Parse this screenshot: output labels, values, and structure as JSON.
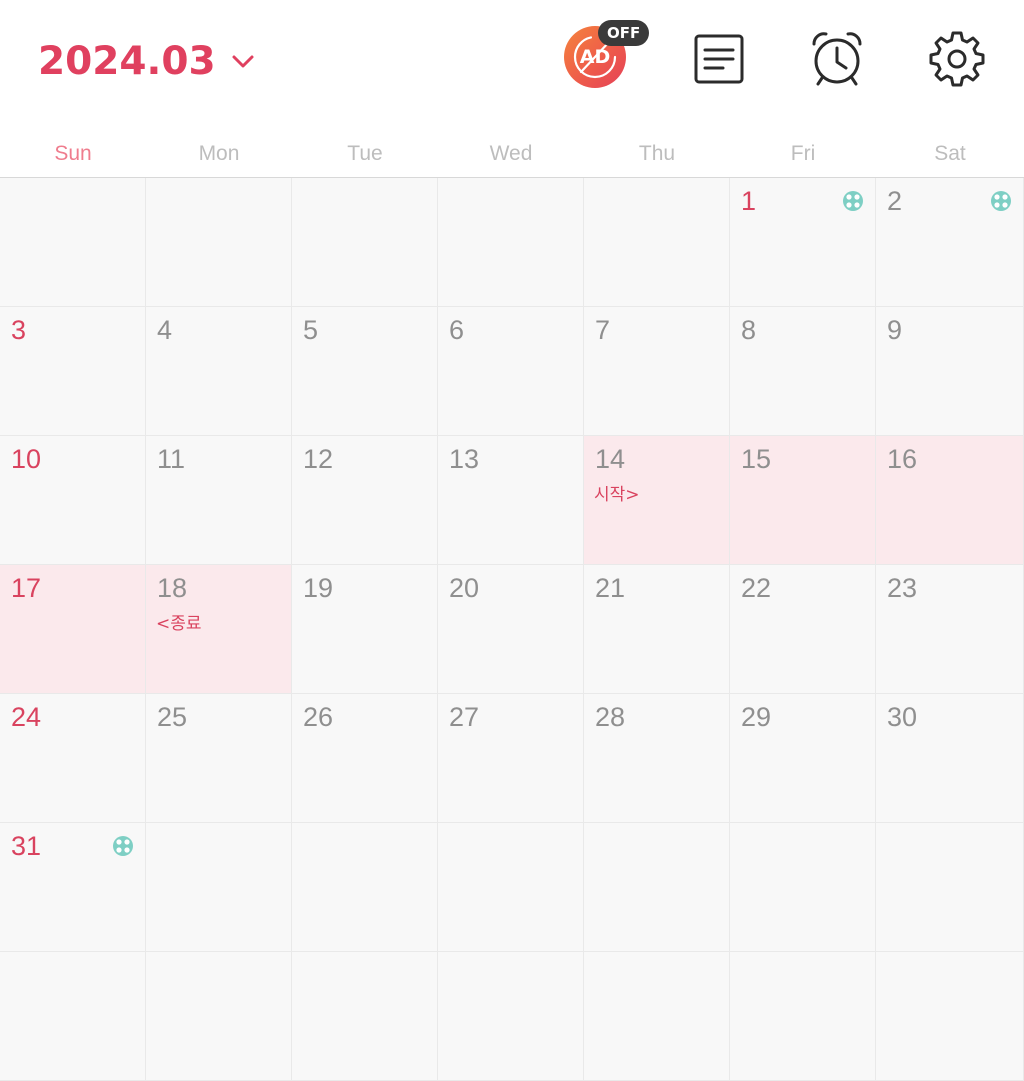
{
  "header": {
    "month_title": "2024.03",
    "ad_button": {
      "label": "AD",
      "badge": "OFF"
    },
    "icons": [
      "chevron-down-icon",
      "memo-icon",
      "alarm-clock-icon",
      "gear-icon"
    ]
  },
  "weekdays": [
    "Sun",
    "Mon",
    "Tue",
    "Wed",
    "Thu",
    "Fri",
    "Sat"
  ],
  "colors": {
    "accent": "#e0405f",
    "sunday_holiday": "#d9435f",
    "range_highlight": "#fbe9ec",
    "event_dot": "#7ecfc4",
    "ad_gradient_start": "#f5843c",
    "ad_gradient_end": "#e54158"
  },
  "calendar": {
    "weeks": [
      [
        {
          "day": ""
        },
        {
          "day": ""
        },
        {
          "day": ""
        },
        {
          "day": ""
        },
        {
          "day": ""
        },
        {
          "day": "1",
          "holiday": true,
          "dot": true
        },
        {
          "day": "2",
          "dot": true
        }
      ],
      [
        {
          "day": "3"
        },
        {
          "day": "4"
        },
        {
          "day": "5"
        },
        {
          "day": "6"
        },
        {
          "day": "7"
        },
        {
          "day": "8"
        },
        {
          "day": "9"
        }
      ],
      [
        {
          "day": "10"
        },
        {
          "day": "11"
        },
        {
          "day": "12"
        },
        {
          "day": "13"
        },
        {
          "day": "14",
          "highlight": true,
          "label": "시작>"
        },
        {
          "day": "15",
          "highlight": true
        },
        {
          "day": "16",
          "highlight": true
        }
      ],
      [
        {
          "day": "17",
          "highlight": true
        },
        {
          "day": "18",
          "highlight": true,
          "label": "<종료"
        },
        {
          "day": "19"
        },
        {
          "day": "20"
        },
        {
          "day": "21"
        },
        {
          "day": "22"
        },
        {
          "day": "23"
        }
      ],
      [
        {
          "day": "24"
        },
        {
          "day": "25"
        },
        {
          "day": "26"
        },
        {
          "day": "27"
        },
        {
          "day": "28"
        },
        {
          "day": "29"
        },
        {
          "day": "30"
        }
      ],
      [
        {
          "day": "31",
          "dot": true
        },
        {
          "day": ""
        },
        {
          "day": ""
        },
        {
          "day": ""
        },
        {
          "day": ""
        },
        {
          "day": ""
        },
        {
          "day": ""
        }
      ],
      [
        {
          "day": ""
        },
        {
          "day": ""
        },
        {
          "day": ""
        },
        {
          "day": ""
        },
        {
          "day": ""
        },
        {
          "day": ""
        },
        {
          "day": ""
        }
      ]
    ]
  }
}
